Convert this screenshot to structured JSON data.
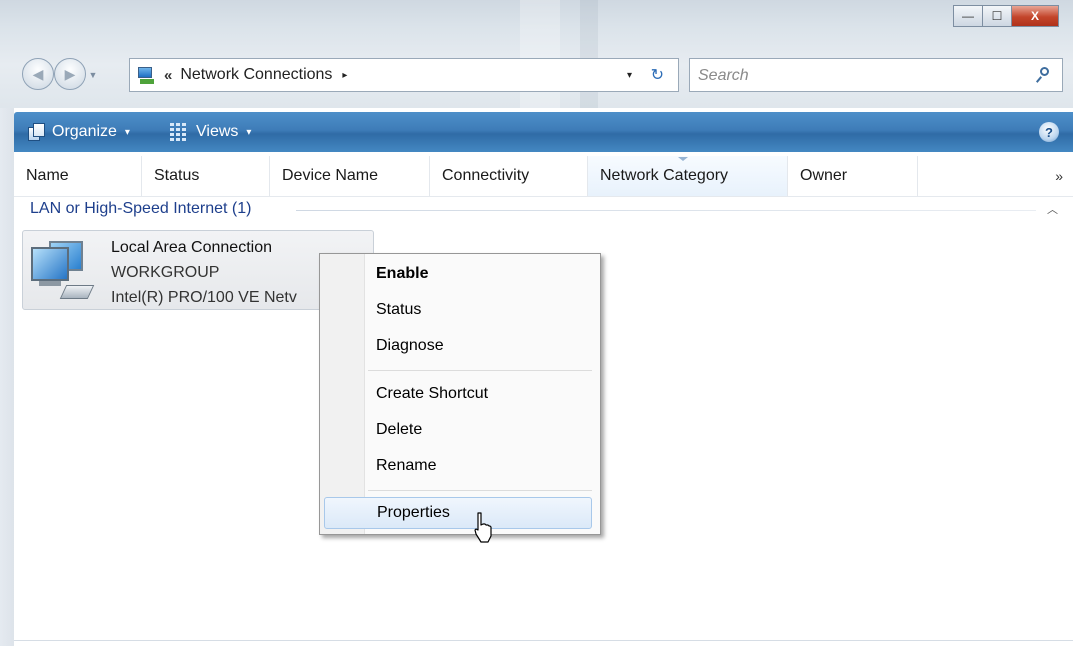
{
  "window": {
    "caption_buttons": {
      "minimize": "—",
      "maximize": "☐",
      "close": "X"
    }
  },
  "address_bar": {
    "chevron": "«",
    "location": "Network Connections",
    "arrow": "▸",
    "dropdown": "▾",
    "refresh": "↻"
  },
  "search": {
    "placeholder": "Search"
  },
  "command_bar": {
    "organize_label": "Organize",
    "views_label": "Views",
    "caret": "▾",
    "help": "?"
  },
  "columns": {
    "headers": [
      "Name",
      "Status",
      "Device Name",
      "Connectivity",
      "Network Category",
      "Owner"
    ],
    "more": "»"
  },
  "group": {
    "label": "LAN or High-Speed Internet (1)",
    "collapse": "︿"
  },
  "connection": {
    "name": "Local Area Connection",
    "workgroup": "WORKGROUP",
    "device": "Intel(R) PRO/100 VE Netv"
  },
  "context_menu": {
    "items": [
      "Enable",
      "Status",
      "Diagnose",
      "Create Shortcut",
      "Delete",
      "Rename",
      "Properties"
    ],
    "default_item": "Enable",
    "hovered_item": "Properties"
  }
}
